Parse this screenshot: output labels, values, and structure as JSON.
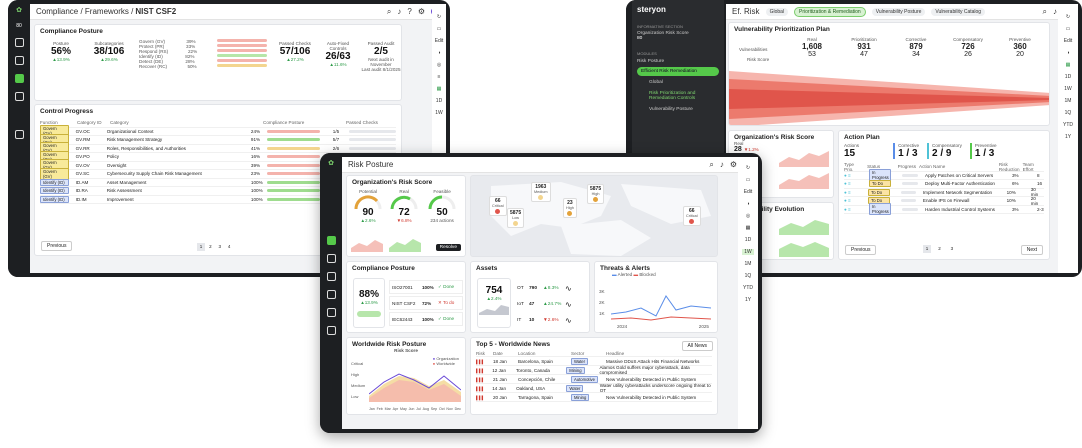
{
  "left": {
    "title_prefix": "Compliance / Frameworks /",
    "title": "NIST CSF2",
    "score_label": "80",
    "posture": {
      "title": "Compliance Posture",
      "posture_label": "Posture",
      "posture_value": "56%",
      "posture_delta": "▲13.9%",
      "sub_label": "Subcategories",
      "sub_value": "38/106",
      "sub_delta": "▲29.6%",
      "functions": [
        {
          "name": "Govern (GV)",
          "pct": "39%"
        },
        {
          "name": "Protect (PR)",
          "pct": "33%"
        },
        {
          "name": "Respond (RS)",
          "pct": "22%"
        },
        {
          "name": "Identify (ID)",
          "pct": "82%"
        },
        {
          "name": "Detect (DE)",
          "pct": "28%"
        },
        {
          "name": "Recover (RC)",
          "pct": "50%"
        }
      ],
      "passed_label": "Passed Checks",
      "passed_value": "57/106",
      "passed_delta": "▲27.2%",
      "auto_label": "Auto-Fixed Controls",
      "auto_value": "26/63",
      "auto_delta": "▲11.6%",
      "audit_label": "Passed Audit",
      "audit_value": "2/5",
      "audit_note": "Next audit in November",
      "audit_last": "Last audit 8/1/2025"
    },
    "progress": {
      "title": "Control Progress",
      "headers": [
        "Function",
        "Category ID",
        "Category",
        "Compliance Posture",
        "Passed Checks"
      ],
      "rows": [
        {
          "fn": "Govern (GV)",
          "id": "GV.OC",
          "cat": "Organizational Context",
          "pct": "24%",
          "checks": "1/5"
        },
        {
          "fn": "Govern (GV)",
          "id": "GV.RM",
          "cat": "Risk Management Strategy",
          "pct": "91%",
          "checks": "5/7"
        },
        {
          "fn": "Govern (GV)",
          "id": "GV.RR",
          "cat": "Roles, Responsibilities, and Authorities",
          "pct": "41%",
          "checks": "2/6"
        },
        {
          "fn": "Govern (GV)",
          "id": "GV.PO",
          "cat": "Policy",
          "pct": "16%",
          "checks": "2/7"
        },
        {
          "fn": "Govern (GV)",
          "id": "GV.OV",
          "cat": "Oversight",
          "pct": "39%",
          "checks": "2/6"
        },
        {
          "fn": "Govern (GV)",
          "id": "GV.SC",
          "cat": "Cybersecurity Supply Chain Risk Management",
          "pct": "23%",
          "checks": "5/10"
        },
        {
          "fn": "Identify (ID)",
          "id": "ID.AM",
          "cat": "Asset Management",
          "pct": "100%",
          "checks": "5/5"
        },
        {
          "fn": "Identify (ID)",
          "id": "ID.RA",
          "cat": "Risk Assessment",
          "pct": "100%",
          "checks": "3/3"
        },
        {
          "fn": "Identify (ID)",
          "id": "ID.IM",
          "cat": "Improvement",
          "pct": "100%",
          "checks": "2/2"
        }
      ],
      "prev": "Previous",
      "pages": [
        "1",
        "2",
        "3",
        "4"
      ]
    },
    "edit": "Edit",
    "ranges": [
      "1D",
      "1W"
    ]
  },
  "right": {
    "brand": "steryon",
    "section_label": "INFORMATIVE SECTION",
    "org_score": "Organization Risk Score",
    "score_num": "80",
    "modules_label": "MODULES",
    "nav": [
      "Risk Posture",
      "Efficient Risk Remediation",
      "Global",
      "Risk Prioritization and Remediation Controls",
      "Vulnerability Posture"
    ],
    "title": "Ef. Risk",
    "tabs": [
      "Global",
      "Prioritization & Remediation",
      "Vulnerability Posture",
      "Vulnerability Catalog"
    ],
    "plan_title": "Vulnerability Prioritization Plan",
    "plan_cols": [
      {
        "h": "Real",
        "v": "1,608",
        "s": "53"
      },
      {
        "h": "Prioritization",
        "v": "931",
        "s": "47"
      },
      {
        "h": "Corrective",
        "v": "879",
        "s": "34"
      },
      {
        "h": "Compensatory",
        "v": "726",
        "s": "26"
      },
      {
        "h": "Preventive",
        "v": "360",
        "s": "20"
      }
    ],
    "plan_rows": [
      "Vulnerabilities",
      "Risk Score"
    ],
    "ors_title": "Organization's Risk Score",
    "ors_real": "Real",
    "ors_v1": "28",
    "ors_d1": "▼1.2%",
    "ors_v2": "45",
    "ors_d2": "▼0.6%",
    "evo_title": "Vulnerability Evolution",
    "evo_d1": "▼1.2%",
    "evo_d2": "▼5.8%",
    "action_title": "Action Plan",
    "actions_label": "Actions",
    "actions_value": "15",
    "corr_label": "Corrective",
    "corr_value": "1 / 3",
    "comp_label": "Compensatory",
    "comp_value": "2 / 9",
    "prev_label": "Preventive",
    "prev_value": "1 / 3",
    "ap_headers": [
      "Type Prio.",
      "Status",
      "Progress",
      "Action Name",
      "Risk Reduction",
      "Team Effort"
    ],
    "ap_rows": [
      {
        "st": "In Progress",
        "name": "Apply Patches on Critical Servers",
        "rr": "3%",
        "te": "8"
      },
      {
        "st": "To Do",
        "name": "Deploy Multi-Factor Authentication",
        "rr": "6%",
        "te": "16"
      },
      {
        "st": "To Do",
        "name": "Implement Network Segmentation",
        "rr": "10%",
        "te": "30 min"
      },
      {
        "st": "To Do",
        "name": "Enable IPS on Firewall",
        "rr": "10%",
        "te": "20 min"
      },
      {
        "st": "In Progress",
        "name": "Harden Industrial Control Systems",
        "rr": "3%",
        "te": "2-3"
      }
    ],
    "prev": "Previous",
    "next": "Next",
    "pages": [
      "1",
      "2",
      "3"
    ],
    "edit": "Edit",
    "ranges": [
      "1D",
      "1W",
      "1M",
      "1Q",
      "YTD",
      "1Y"
    ]
  },
  "center": {
    "title": "Risk Posture",
    "ors": {
      "title": "Organization's Risk Score",
      "potential": "Potential",
      "p_val": "90",
      "p_d": "▲2.6%",
      "real": "Real",
      "r_val": "72",
      "r_d": "▼6.8%",
      "feasible": "Feasible",
      "f_val": "50",
      "f_note": "234 actions",
      "resolve": "Resolve"
    },
    "map": [
      {
        "v": "1963",
        "l": "Medium"
      },
      {
        "v": "5875",
        "l": "High"
      },
      {
        "v": "66",
        "l": "Critical"
      },
      {
        "v": "5875",
        "l": "Low"
      },
      {
        "v": "23",
        "l": "High"
      },
      {
        "v": "66",
        "l": "Critical"
      }
    ],
    "cp": {
      "title": "Compliance Posture",
      "value": "88%",
      "delta": "▲13.9%",
      "rows": [
        {
          "n": "ISO27001",
          "p": "100%",
          "s": "✓ Done"
        },
        {
          "n": "NIST CSF2",
          "p": "72%",
          "s": "✕ To do"
        },
        {
          "n": "IEC62443",
          "p": "100%",
          "s": "✓ Done"
        }
      ]
    },
    "assets": {
      "title": "Assets",
      "value": "754",
      "delta": "▲2.4%",
      "rows": [
        {
          "n": "OT",
          "v": "790",
          "d": "▲8.3%"
        },
        {
          "n": "IoT",
          "v": "47",
          "d": "▲24.7%"
        },
        {
          "n": "IT",
          "v": "10",
          "d": "▼2.6%"
        }
      ]
    },
    "threats": {
      "title": "Threats & Alerts",
      "legend": [
        "Alerted",
        "Blocked"
      ],
      "y": [
        "3K",
        "2K",
        "1K"
      ],
      "x": [
        "2024",
        "2025"
      ]
    },
    "wrp": {
      "title": "Worldwide Risk Posture",
      "chart": "Risk Score",
      "y": [
        "Critical",
        "High",
        "Medium",
        "Low"
      ],
      "legend": [
        "Organization",
        "Worldwide"
      ],
      "x": [
        "Jan",
        "Feb",
        "Mar",
        "Apr",
        "May",
        "Jun",
        "Jul",
        "Aug",
        "Sep",
        "Oct",
        "Nov",
        "Dec"
      ]
    },
    "news": {
      "title": "Top 5 - Worldwide News",
      "all": "All News",
      "headers": [
        "Risk",
        "Date",
        "Location",
        "Sector",
        "Headline"
      ],
      "rows": [
        {
          "d": "18 Jan",
          "loc": "Barcelona, Spain",
          "sec": "Water",
          "h": "Massive DDoS Attack Hits Financial Networks"
        },
        {
          "d": "12 Jan",
          "loc": "Toronto, Canada",
          "sec": "Mining",
          "h": "Alamos Gold suffers major cyberattack, data compromised"
        },
        {
          "d": "21 Jan",
          "loc": "Concepción, Chile",
          "sec": "Automotive",
          "h": "New Vulnerability Detected in Public System"
        },
        {
          "d": "14 Jan",
          "loc": "Oakland, USA",
          "sec": "Water",
          "h": "Water utility cyberattacks underscore ongoing threat to OT"
        },
        {
          "d": "20 Jan",
          "loc": "Tarragona, Spain",
          "sec": "Mining",
          "h": "New Vulnerability Detected in Public System"
        }
      ]
    },
    "ranges": [
      "1D",
      "1W",
      "1M",
      "1Q",
      "YTD",
      "1Y"
    ],
    "edit": "Edit"
  },
  "colors": {
    "accent": "#55c94a",
    "red": "#e0554b",
    "amber": "#e3a23a"
  }
}
